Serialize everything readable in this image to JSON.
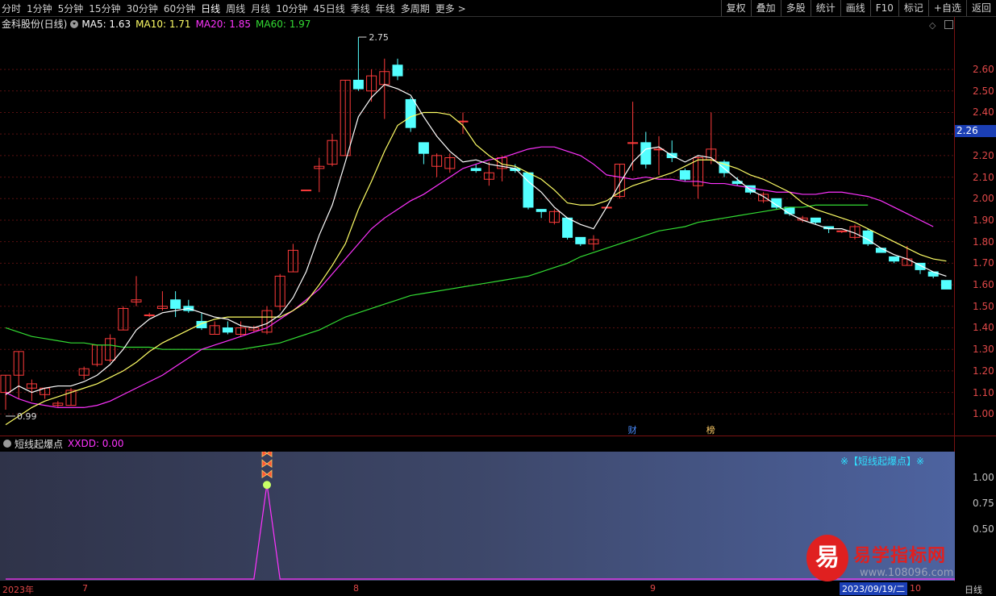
{
  "toolbar": {
    "periods": [
      "分时",
      "1分钟",
      "5分钟",
      "15分钟",
      "30分钟",
      "60分钟",
      "日线",
      "周线",
      "月线",
      "10分钟",
      "45日线",
      "季线",
      "年线",
      "多周期",
      "更多 >"
    ],
    "active_period": "日线",
    "right_buttons": [
      "复权",
      "叠加",
      "多股",
      "统计",
      "画线",
      "F10",
      "标记",
      "+自选",
      "返回"
    ]
  },
  "legend": {
    "stock": "金科股份(日线)",
    "ma5": "MA5: 1.63",
    "ma10": "MA10: 1.71",
    "ma20": "MA20: 1.85",
    "ma60": "MA60: 1.97"
  },
  "colors": {
    "up": "#ff3b3b",
    "down": "#54ffff",
    "ma5": "#ffffff",
    "ma10": "#ffff66",
    "ma20": "#ff33ff",
    "ma60": "#33dd33",
    "axis_text": "#e04848",
    "price_tag": "#1b3fb5"
  },
  "price_axis": {
    "ticks": [
      "2.60",
      "2.50",
      "2.40",
      "2.30",
      "2.20",
      "2.10",
      "2.00",
      "1.90",
      "1.80",
      "1.70",
      "1.60",
      "1.50",
      "1.40",
      "1.30",
      "1.20",
      "1.10",
      "1.00"
    ],
    "current_price": "2.26",
    "high_label": "2.75",
    "low_label": "0.99"
  },
  "event_marks": [
    {
      "text": "财",
      "color": "#4a8cff"
    },
    {
      "text": "榜",
      "color": "#ffcc66"
    }
  ],
  "sub_legend": {
    "name": "短线起爆点",
    "value": "XXDD: 0.00"
  },
  "sub_axis": {
    "ticks": [
      "1.00",
      "0.75",
      "0.50"
    ]
  },
  "indicator_title": "※【短线起爆点】※",
  "date_axis": {
    "labels": [
      "2023年",
      "7",
      "8",
      "9",
      "10"
    ],
    "cursor_date": "2023/09/19/二",
    "period": "日线"
  },
  "watermark": {
    "logo": "易",
    "title": "易学指标网",
    "url": "www.108096.com"
  },
  "chart_data": {
    "type": "candlestick",
    "candles": [
      {
        "o": 1.1,
        "h": 1.18,
        "l": 1.02,
        "c": 1.18
      },
      {
        "o": 1.18,
        "h": 1.29,
        "l": 1.07,
        "c": 1.29
      },
      {
        "o": 1.12,
        "h": 1.16,
        "l": 1.06,
        "c": 1.14
      },
      {
        "o": 1.09,
        "h": 1.12,
        "l": 1.07,
        "c": 1.12
      },
      {
        "o": 1.04,
        "h": 1.06,
        "l": 1.03,
        "c": 1.05
      },
      {
        "o": 1.04,
        "h": 1.12,
        "l": 1.04,
        "c": 1.11
      },
      {
        "o": 1.18,
        "h": 1.22,
        "l": 1.16,
        "c": 1.21
      },
      {
        "o": 1.23,
        "h": 1.32,
        "l": 1.22,
        "c": 1.32
      },
      {
        "o": 1.25,
        "h": 1.37,
        "l": 1.24,
        "c": 1.35
      },
      {
        "o": 1.39,
        "h": 1.5,
        "l": 1.39,
        "c": 1.49
      },
      {
        "o": 1.52,
        "h": 1.64,
        "l": 1.5,
        "c": 1.53
      },
      {
        "o": 1.46,
        "h": 1.47,
        "l": 1.45,
        "c": 1.46
      },
      {
        "o": 1.49,
        "h": 1.57,
        "l": 1.48,
        "c": 1.5
      },
      {
        "o": 1.53,
        "h": 1.57,
        "l": 1.45,
        "c": 1.49
      },
      {
        "o": 1.5,
        "h": 1.53,
        "l": 1.47,
        "c": 1.48
      },
      {
        "o": 1.43,
        "h": 1.47,
        "l": 1.39,
        "c": 1.4
      },
      {
        "o": 1.37,
        "h": 1.43,
        "l": 1.37,
        "c": 1.41
      },
      {
        "o": 1.4,
        "h": 1.43,
        "l": 1.37,
        "c": 1.38
      },
      {
        "o": 1.37,
        "h": 1.43,
        "l": 1.36,
        "c": 1.4
      },
      {
        "o": 1.39,
        "h": 1.41,
        "l": 1.38,
        "c": 1.4
      },
      {
        "o": 1.38,
        "h": 1.5,
        "l": 1.37,
        "c": 1.48
      },
      {
        "o": 1.5,
        "h": 1.65,
        "l": 1.48,
        "c": 1.64
      },
      {
        "o": 1.66,
        "h": 1.79,
        "l": 1.66,
        "c": 1.76
      },
      {
        "o": 2.04,
        "h": 2.04,
        "l": 2.04,
        "c": 2.04
      },
      {
        "o": 2.14,
        "h": 2.19,
        "l": 2.03,
        "c": 2.15
      },
      {
        "o": 2.16,
        "h": 2.3,
        "l": 2.15,
        "c": 2.27
      },
      {
        "o": 2.2,
        "h": 2.55,
        "l": 2.2,
        "c": 2.55
      },
      {
        "o": 2.55,
        "h": 2.75,
        "l": 2.5,
        "c": 2.51
      },
      {
        "o": 2.5,
        "h": 2.6,
        "l": 2.45,
        "c": 2.57
      },
      {
        "o": 2.53,
        "h": 2.65,
        "l": 2.37,
        "c": 2.59
      },
      {
        "o": 2.62,
        "h": 2.65,
        "l": 2.55,
        "c": 2.57
      },
      {
        "o": 2.46,
        "h": 2.47,
        "l": 2.31,
        "c": 2.33
      },
      {
        "o": 2.26,
        "h": 2.26,
        "l": 2.16,
        "c": 2.21
      },
      {
        "o": 2.15,
        "h": 2.21,
        "l": 2.1,
        "c": 2.2
      },
      {
        "o": 2.14,
        "h": 2.21,
        "l": 2.12,
        "c": 2.19
      },
      {
        "o": 2.36,
        "h": 2.4,
        "l": 2.3,
        "c": 2.36
      },
      {
        "o": 2.14,
        "h": 2.16,
        "l": 2.12,
        "c": 2.13
      },
      {
        "o": 2.09,
        "h": 2.17,
        "l": 2.06,
        "c": 2.12
      },
      {
        "o": 2.14,
        "h": 2.2,
        "l": 2.08,
        "c": 2.19
      },
      {
        "o": 2.14,
        "h": 2.16,
        "l": 2.12,
        "c": 2.13
      },
      {
        "o": 2.12,
        "h": 2.12,
        "l": 1.95,
        "c": 1.96
      },
      {
        "o": 1.95,
        "h": 1.95,
        "l": 1.91,
        "c": 1.94
      },
      {
        "o": 1.89,
        "h": 1.95,
        "l": 1.88,
        "c": 1.94
      },
      {
        "o": 1.91,
        "h": 1.91,
        "l": 1.81,
        "c": 1.82
      },
      {
        "o": 1.82,
        "h": 1.82,
        "l": 1.78,
        "c": 1.79
      },
      {
        "o": 1.79,
        "h": 1.83,
        "l": 1.76,
        "c": 1.81
      },
      {
        "o": 1.96,
        "h": 1.96,
        "l": 1.96,
        "c": 1.96
      },
      {
        "o": 2.01,
        "h": 2.16,
        "l": 2.0,
        "c": 2.16
      },
      {
        "o": 2.26,
        "h": 2.45,
        "l": 2.13,
        "c": 2.26
      },
      {
        "o": 2.26,
        "h": 2.31,
        "l": 2.14,
        "c": 2.16
      },
      {
        "o": 2.23,
        "h": 2.29,
        "l": 2.11,
        "c": 2.23
      },
      {
        "o": 2.21,
        "h": 2.27,
        "l": 2.17,
        "c": 2.19
      },
      {
        "o": 2.13,
        "h": 2.14,
        "l": 2.08,
        "c": 2.09
      },
      {
        "o": 2.06,
        "h": 2.2,
        "l": 2.0,
        "c": 2.19
      },
      {
        "o": 2.18,
        "h": 2.4,
        "l": 2.16,
        "c": 2.23
      },
      {
        "o": 2.17,
        "h": 2.18,
        "l": 2.1,
        "c": 2.12
      },
      {
        "o": 2.08,
        "h": 2.1,
        "l": 2.06,
        "c": 2.07
      },
      {
        "o": 2.06,
        "h": 2.06,
        "l": 2.02,
        "c": 2.03
      },
      {
        "o": 1.99,
        "h": 2.03,
        "l": 1.98,
        "c": 2.02
      },
      {
        "o": 2.0,
        "h": 2.0,
        "l": 1.95,
        "c": 1.96
      },
      {
        "o": 1.96,
        "h": 1.96,
        "l": 1.92,
        "c": 1.93
      },
      {
        "o": 1.9,
        "h": 1.92,
        "l": 1.89,
        "c": 1.91
      },
      {
        "o": 1.91,
        "h": 1.91,
        "l": 1.88,
        "c": 1.89
      },
      {
        "o": 1.87,
        "h": 1.87,
        "l": 1.84,
        "c": 1.86
      },
      {
        "o": 1.85,
        "h": 1.85,
        "l": 1.84,
        "c": 1.85
      },
      {
        "o": 1.82,
        "h": 1.88,
        "l": 1.81,
        "c": 1.87
      },
      {
        "o": 1.85,
        "h": 1.86,
        "l": 1.78,
        "c": 1.79
      },
      {
        "o": 1.77,
        "h": 1.77,
        "l": 1.75,
        "c": 1.75
      },
      {
        "o": 1.73,
        "h": 1.73,
        "l": 1.7,
        "c": 1.71
      },
      {
        "o": 1.69,
        "h": 1.78,
        "l": 1.69,
        "c": 1.72
      },
      {
        "o": 1.7,
        "h": 1.7,
        "l": 1.65,
        "c": 1.67
      },
      {
        "o": 1.66,
        "h": 1.66,
        "l": 1.63,
        "c": 1.64
      },
      {
        "o": 1.62,
        "h": 1.62,
        "l": 1.58,
        "c": 1.58
      },
      {
        "o": 1.58,
        "h": 1.62,
        "l": 1.55,
        "c": 1.58
      }
    ],
    "ma5": [
      1.09,
      1.13,
      1.1,
      1.12,
      1.13,
      1.13,
      1.15,
      1.18,
      1.23,
      1.3,
      1.39,
      1.44,
      1.47,
      1.48,
      1.49,
      1.47,
      1.45,
      1.44,
      1.41,
      1.4,
      1.42,
      1.46,
      1.54,
      1.66,
      1.83,
      1.97,
      2.17,
      2.38,
      2.47,
      2.53,
      2.51,
      2.48,
      2.38,
      2.29,
      2.22,
      2.17,
      2.18,
      2.16,
      2.15,
      2.14,
      2.08,
      2.03,
      1.96,
      1.91,
      1.88,
      1.86,
      1.96,
      2.07,
      2.17,
      2.23,
      2.24,
      2.2,
      2.17,
      2.2,
      2.19,
      2.14,
      2.09,
      2.04,
      2.01,
      1.97,
      1.93,
      1.9,
      1.88,
      1.86,
      1.86,
      1.84,
      1.81,
      1.77,
      1.74,
      1.72,
      1.69,
      1.66,
      1.64
    ],
    "ma10": [
      0.95,
      0.99,
      1.03,
      1.06,
      1.08,
      1.1,
      1.12,
      1.14,
      1.17,
      1.2,
      1.24,
      1.29,
      1.33,
      1.36,
      1.39,
      1.42,
      1.44,
      1.45,
      1.45,
      1.45,
      1.45,
      1.45,
      1.48,
      1.52,
      1.6,
      1.69,
      1.79,
      1.95,
      2.08,
      2.22,
      2.34,
      2.38,
      2.4,
      2.4,
      2.39,
      2.34,
      2.25,
      2.2,
      2.16,
      2.15,
      2.12,
      2.09,
      2.04,
      1.98,
      1.97,
      1.97,
      1.99,
      2.03,
      2.06,
      2.08,
      2.1,
      2.12,
      2.15,
      2.18,
      2.18,
      2.16,
      2.14,
      2.11,
      2.09,
      2.06,
      2.03,
      1.98,
      1.95,
      1.93,
      1.91,
      1.89,
      1.86,
      1.83,
      1.8,
      1.77,
      1.74,
      1.72,
      1.71
    ],
    "ma20": [
      1.1,
      1.07,
      1.05,
      1.04,
      1.03,
      1.03,
      1.03,
      1.04,
      1.06,
      1.09,
      1.12,
      1.15,
      1.18,
      1.22,
      1.26,
      1.3,
      1.32,
      1.34,
      1.36,
      1.38,
      1.4,
      1.44,
      1.48,
      1.53,
      1.58,
      1.65,
      1.72,
      1.79,
      1.86,
      1.91,
      1.95,
      1.99,
      2.02,
      2.06,
      2.1,
      2.14,
      2.16,
      2.18,
      2.19,
      2.21,
      2.23,
      2.24,
      2.24,
      2.22,
      2.2,
      2.16,
      2.11,
      2.1,
      2.09,
      2.1,
      2.09,
      2.09,
      2.08,
      2.08,
      2.07,
      2.07,
      2.06,
      2.05,
      2.04,
      2.03,
      2.03,
      2.02,
      2.02,
      2.03,
      2.03,
      2.02,
      2.01,
      1.99,
      1.96,
      1.93,
      1.9,
      1.87
    ],
    "ma60": [
      1.4,
      1.38,
      1.36,
      1.35,
      1.34,
      1.33,
      1.33,
      1.32,
      1.32,
      1.31,
      1.31,
      1.31,
      1.3,
      1.3,
      1.3,
      1.3,
      1.3,
      1.3,
      1.3,
      1.31,
      1.32,
      1.33,
      1.35,
      1.37,
      1.39,
      1.42,
      1.45,
      1.47,
      1.49,
      1.51,
      1.53,
      1.55,
      1.56,
      1.57,
      1.58,
      1.59,
      1.6,
      1.61,
      1.62,
      1.63,
      1.64,
      1.66,
      1.68,
      1.7,
      1.73,
      1.75,
      1.77,
      1.79,
      1.81,
      1.83,
      1.85,
      1.86,
      1.87,
      1.89,
      1.9,
      1.91,
      1.92,
      1.93,
      1.94,
      1.95,
      1.96,
      1.96,
      1.97,
      1.97,
      1.97,
      1.97,
      1.97
    ],
    "ylim": [
      0.9,
      2.78
    ],
    "indicator": {
      "name": "XXDD",
      "signal_index": 20,
      "signal_value": 0.92,
      "ylim": [
        0,
        1.25
      ]
    }
  }
}
